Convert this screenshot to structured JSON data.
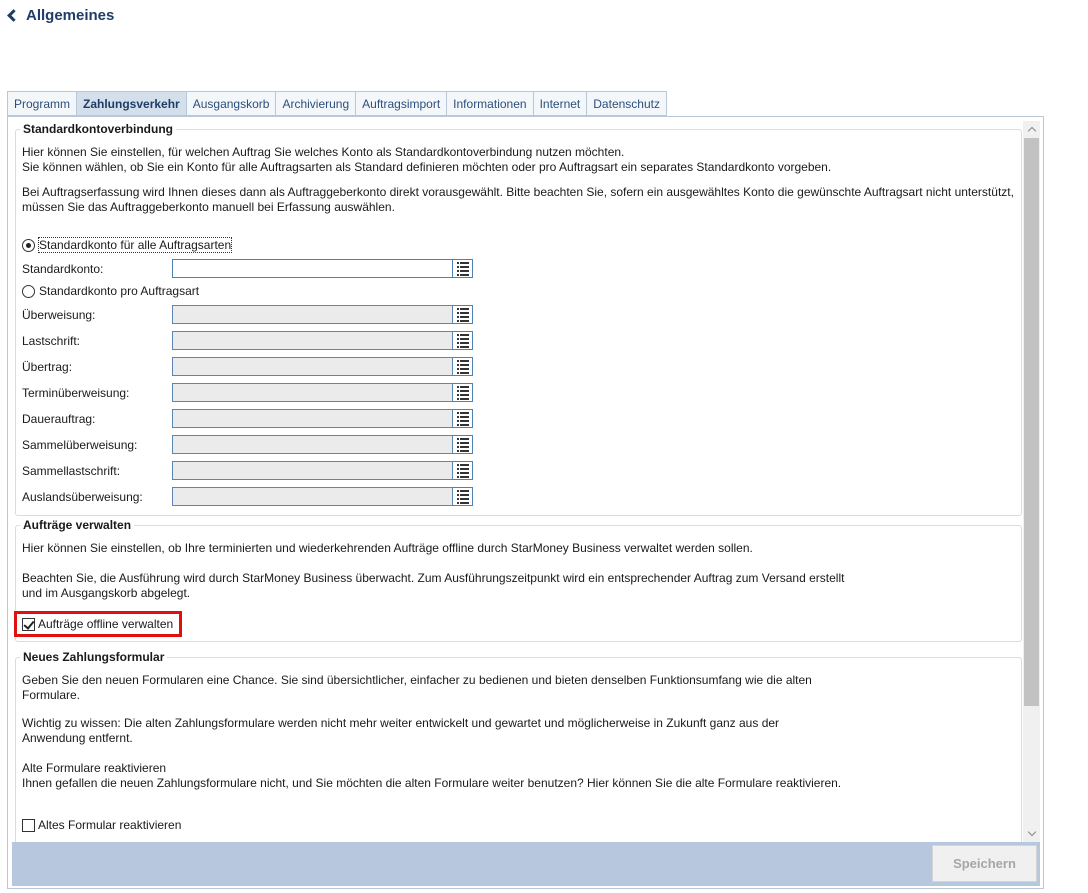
{
  "header": {
    "title": "Allgemeines"
  },
  "tabs": [
    {
      "label": "Programm"
    },
    {
      "label": "Zahlungsverkehr",
      "active": true
    },
    {
      "label": "Ausgangskorb"
    },
    {
      "label": "Archivierung"
    },
    {
      "label": "Auftragsimport"
    },
    {
      "label": "Informationen"
    },
    {
      "label": "Internet"
    },
    {
      "label": "Datenschutz"
    }
  ],
  "standard": {
    "title": "Standardkontoverbindung",
    "p1": "Hier können Sie einstellen, für welchen Auftrag Sie welches Konto als Standardkontoverbindung nutzen möchten.",
    "p2": "Sie können wählen, ob Sie ein Konto für alle Auftragsarten als Standard definieren möchten oder pro Auftragsart ein separates Standardkonto vorgeben.",
    "p3": "Bei Auftragserfassung wird Ihnen dieses dann als Auftraggeberkonto direkt vorausgewählt. Bitte beachten Sie, sofern ein ausgewähltes Konto die gewünschte Auftragsart nicht unterstützt,",
    "p4": "müssen Sie das Auftraggeberkonto manuell bei Erfassung auswählen.",
    "radio_all": "Standardkonto für alle Auftragsarten",
    "radio_all_selected": true,
    "label_standard": "Standardkonto:",
    "value_standard": "",
    "radio_per": "Standardkonto pro Auftragsart",
    "fields": [
      {
        "label": "Überweisung:",
        "value": ""
      },
      {
        "label": "Lastschrift:",
        "value": ""
      },
      {
        "label": "Übertrag:",
        "value": ""
      },
      {
        "label": "Terminüberweisung:",
        "value": ""
      },
      {
        "label": "Dauerauftrag:",
        "value": ""
      },
      {
        "label": "Sammelüberweisung:",
        "value": ""
      },
      {
        "label": "Sammellastschrift:",
        "value": ""
      },
      {
        "label": "Auslandsüberweisung:",
        "value": ""
      }
    ]
  },
  "orders": {
    "title": "Aufträge verwalten",
    "p1": "Hier können Sie einstellen, ob Ihre terminierten und wiederkehrenden Aufträge offline durch StarMoney Business verwaltet werden sollen.",
    "p2": "Beachten Sie, die Ausführung wird durch StarMoney Business überwacht. Zum Ausführungszeitpunkt wird ein entsprechender Auftrag zum Versand erstellt",
    "p3": "und im Ausgangskorb abgelegt.",
    "checkbox_label": "Aufträge offline verwalten",
    "checked": true
  },
  "form": {
    "title": "Neues Zahlungsformular",
    "p1": "Geben Sie den neuen Formularen eine Chance. Sie sind übersichtlicher, einfacher zu bedienen und bieten denselben Funktionsumfang wie die alten",
    "p2": "Formulare.",
    "p3": "Wichtig zu wissen: Die alten Zahlungsformulare werden nicht mehr weiter entwickelt und gewartet und möglicherweise in Zukunft ganz aus der",
    "p4": "Anwendung entfernt.",
    "p5": "Alte Formulare reaktivieren",
    "p6": "Ihnen gefallen die neuen Zahlungsformulare nicht, und Sie möchten die alten Formulare weiter benutzen? Hier können Sie die alte Formulare reaktivieren.",
    "checkbox_label": "Altes Formular reaktivieren",
    "checked": false
  },
  "footer": {
    "save_label": "Speichern"
  }
}
